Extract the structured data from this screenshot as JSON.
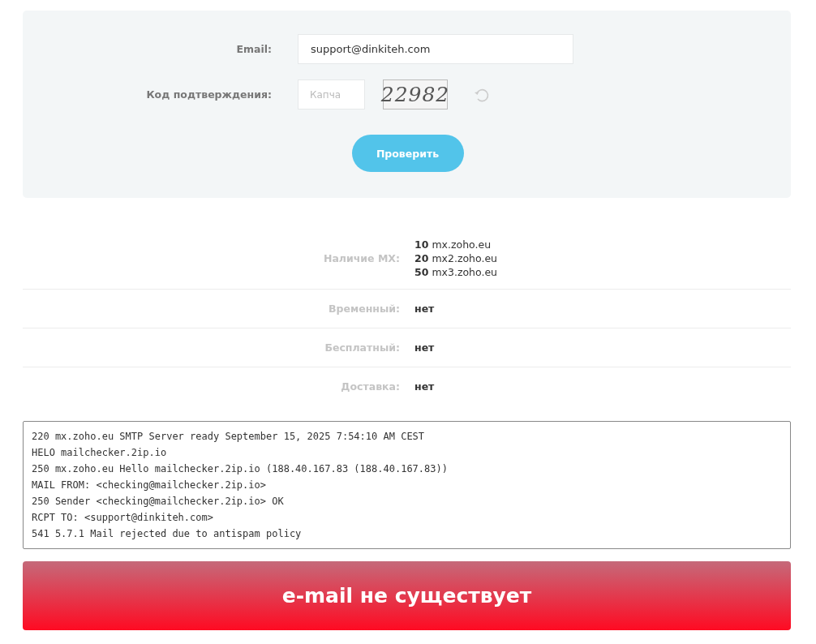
{
  "form": {
    "email": {
      "label": "Email:",
      "value": "support@dinkiteh.com"
    },
    "captcha": {
      "label": "Код подтверждения:",
      "placeholder": "Капча",
      "code": "22982"
    },
    "submit": "Проверить"
  },
  "results": [
    {
      "label": "Наличие MX:",
      "values": [
        "**10** mx.zoho.eu",
        "**20** mx2.zoho.eu",
        "**50** mx3.zoho.eu"
      ]
    },
    {
      "label": "Временный:",
      "values": [
        "нет"
      ]
    },
    {
      "label": "Бесплатный:",
      "values": [
        "нет"
      ]
    },
    {
      "label": "Доставка:",
      "values": [
        "нет"
      ]
    }
  ],
  "log": [
    "220 mx.zoho.eu SMTP Server ready September 15, 2025 7:54:10 AM CEST",
    "HELO mailchecker.2ip.io",
    "250 mx.zoho.eu Hello mailchecker.2ip.io (188.40.167.83 (188.40.167.83))",
    "MAIL FROM: <checking@mailchecker.2ip.io>",
    "250 Sender <checking@mailchecker.2ip.io> OK",
    "RCPT TO: <support@dinkiteh.com>",
    "541 5.7.1 Mail rejected due to antispam policy"
  ],
  "verdict": {
    "text": "e-mail не существует",
    "exists": false
  }
}
